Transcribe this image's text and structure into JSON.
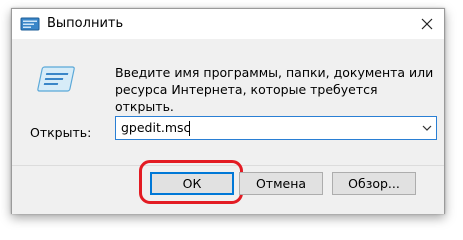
{
  "window": {
    "title": "Выполнить",
    "close_icon": "close-icon"
  },
  "content": {
    "icon": "run-icon",
    "description": "Введите имя программы, папки, документа или ресурса Интернета, которые требуется открыть."
  },
  "open_field": {
    "label": "Открыть:",
    "value": "gpedit.msc"
  },
  "buttons": {
    "ok": "ОК",
    "cancel": "Отмена",
    "browse": "Обзор..."
  },
  "colors": {
    "highlight": "#e31b23",
    "focus": "#0078d7"
  }
}
